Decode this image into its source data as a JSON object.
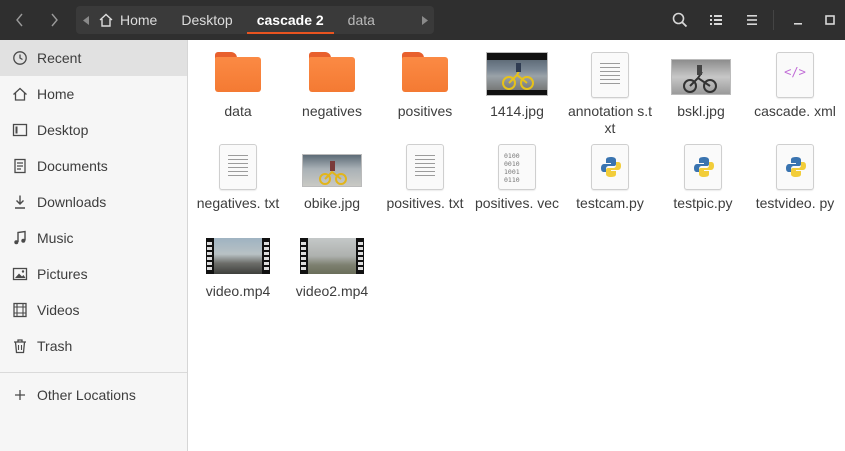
{
  "header": {
    "breadcrumbs": [
      {
        "label": "Home"
      },
      {
        "label": "Desktop"
      },
      {
        "label": "cascade 2"
      },
      {
        "label": "data"
      }
    ],
    "icons": [
      "back-arrow",
      "forward-arrow",
      "search-icon",
      "view-list-icon",
      "menu-icon",
      "minimize-icon",
      "maximize-icon"
    ]
  },
  "sidebar": {
    "items": [
      {
        "label": "Recent",
        "icon": "clock-icon",
        "selected": true
      },
      {
        "label": "Home",
        "icon": "home-icon"
      },
      {
        "label": "Desktop",
        "icon": "desktop-icon"
      },
      {
        "label": "Documents",
        "icon": "documents-icon"
      },
      {
        "label": "Downloads",
        "icon": "download-icon"
      },
      {
        "label": "Music",
        "icon": "music-icon"
      },
      {
        "label": "Pictures",
        "icon": "pictures-icon"
      },
      {
        "label": "Videos",
        "icon": "videos-icon"
      },
      {
        "label": "Trash",
        "icon": "trash-icon"
      }
    ],
    "other": {
      "label": "Other Locations",
      "icon": "plus-icon"
    }
  },
  "files": [
    {
      "name": "data",
      "kind": "folder"
    },
    {
      "name": "negatives",
      "kind": "folder"
    },
    {
      "name": "positives",
      "kind": "folder"
    },
    {
      "name": "1414.jpg",
      "kind": "image"
    },
    {
      "name": "annotation s.txt",
      "kind": "text"
    },
    {
      "name": "bskl.jpg",
      "kind": "image"
    },
    {
      "name": "cascade. xml",
      "kind": "xml"
    },
    {
      "name": "negatives. txt",
      "kind": "text"
    },
    {
      "name": "obike.jpg",
      "kind": "image"
    },
    {
      "name": "positives. txt",
      "kind": "text"
    },
    {
      "name": "positives. vec",
      "kind": "binary"
    },
    {
      "name": "testcam.py",
      "kind": "python"
    },
    {
      "name": "testpic.py",
      "kind": "python"
    },
    {
      "name": "testvideo. py",
      "kind": "python"
    },
    {
      "name": "video.mp4",
      "kind": "video"
    },
    {
      "name": "video2.mp4",
      "kind": "video"
    }
  ],
  "colors": {
    "accent": "#e95420",
    "folder": "#f47a33",
    "headerbar": "#2f2f2f"
  }
}
